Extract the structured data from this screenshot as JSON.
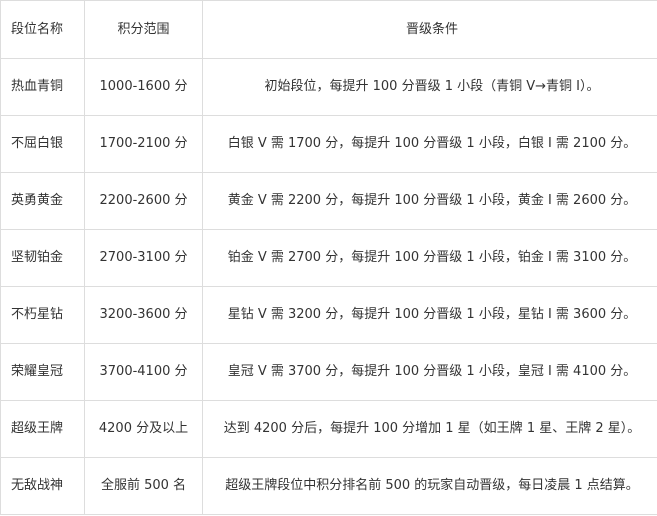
{
  "table": {
    "headers": {
      "name": "段位名称",
      "score": "积分范围",
      "condition": "晋级条件"
    },
    "rows": [
      {
        "name": "热血青铜",
        "score": "1000-1600 分",
        "condition": "初始段位，每提升 100 分晋级 1 小段（青铜 V→青铜 I）。"
      },
      {
        "name": "不屈白银",
        "score": "1700-2100 分",
        "condition": "白银 V 需 1700 分，每提升 100 分晋级 1 小段，白银 I 需 2100 分。"
      },
      {
        "name": "英勇黄金",
        "score": "2200-2600 分",
        "condition": "黄金 V 需 2200 分，每提升 100 分晋级 1 小段，黄金 I 需 2600 分。"
      },
      {
        "name": "坚韧铂金",
        "score": "2700-3100 分",
        "condition": "铂金 V 需 2700 分，每提升 100 分晋级 1 小段，铂金 I 需 3100 分。"
      },
      {
        "name": "不朽星钻",
        "score": "3200-3600 分",
        "condition": "星钻 V 需 3200 分，每提升 100 分晋级 1 小段，星钻 I 需 3600 分。"
      },
      {
        "name": "荣耀皇冠",
        "score": "3700-4100 分",
        "condition": "皇冠 V 需 3700 分，每提升 100 分晋级 1 小段，皇冠 I 需 4100 分。"
      },
      {
        "name": "超级王牌",
        "score": "4200 分及以上",
        "condition": "达到 4200 分后，每提升 100 分增加 1 星（如王牌 1 星、王牌 2 星）。"
      },
      {
        "name": "无敌战神",
        "score": "全服前 500 名",
        "condition": "超级王牌段位中积分排名前 500 的玩家自动晋级，每日凌晨 1 点结算。"
      }
    ]
  }
}
